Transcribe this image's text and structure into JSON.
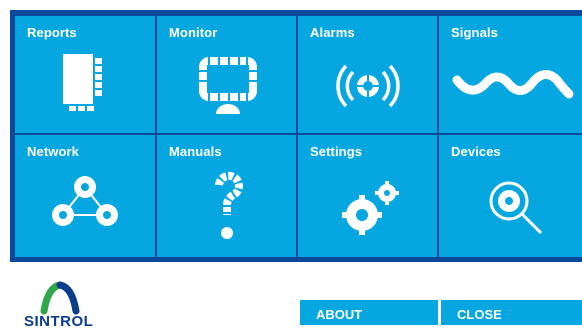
{
  "tiles": {
    "reports": {
      "label": "Reports",
      "icon": "reports-icon"
    },
    "monitor": {
      "label": "Monitor",
      "icon": "monitor-icon"
    },
    "alarms": {
      "label": "Alarms",
      "icon": "alarm-icon"
    },
    "signals": {
      "label": "Signals",
      "icon": "signal-wave-icon"
    },
    "network": {
      "label": "Network",
      "icon": "network-icon"
    },
    "manuals": {
      "label": "Manuals",
      "icon": "question-icon"
    },
    "settings": {
      "label": "Settings",
      "icon": "gears-icon"
    },
    "devices": {
      "label": "Devices",
      "icon": "search-device-icon"
    }
  },
  "footer": {
    "logo_text": "SINTROL",
    "about_label": "ABOUT",
    "close_label": "CLOSE"
  },
  "colors": {
    "frame": "#0b4a9a",
    "tile": "#06a6e0",
    "logo_text": "#0b3d8c"
  }
}
